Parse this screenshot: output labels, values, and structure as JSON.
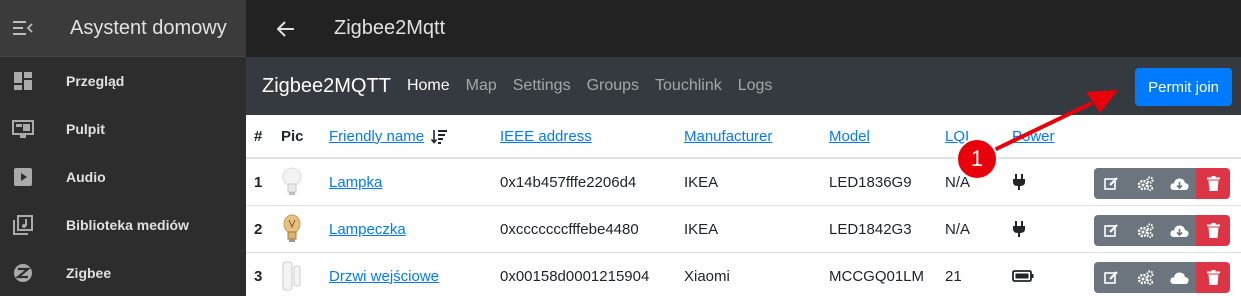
{
  "sidebar": {
    "title": "Asystent domowy",
    "items": [
      {
        "label": "Przegląd",
        "icon": "dashboard-icon"
      },
      {
        "label": "Pulpit",
        "icon": "monitor-icon"
      },
      {
        "label": "Audio",
        "icon": "play-icon"
      },
      {
        "label": "Biblioteka mediów",
        "icon": "media-library-icon"
      },
      {
        "label": "Zigbee",
        "icon": "zigbee-icon"
      }
    ]
  },
  "topbar": {
    "title": "Zigbee2Mqtt"
  },
  "znav": {
    "brand": "Zigbee2MQTT",
    "links": [
      "Home",
      "Map",
      "Settings",
      "Groups",
      "Touchlink",
      "Logs"
    ],
    "active": "Home",
    "permit_label": "Permit join"
  },
  "table": {
    "headers": {
      "num": "#",
      "pic": "Pic",
      "friendly": "Friendly name",
      "ieee": "IEEE address",
      "manufacturer": "Manufacturer",
      "model": "Model",
      "lqi": "LQI",
      "power": "Power"
    },
    "rows": [
      {
        "num": "1",
        "friendly": "Lampka",
        "ieee": "0x14b457fffe2206d4",
        "manufacturer": "IKEA",
        "model": "LED1836G9",
        "lqi": "N/A",
        "power": "plug-icon"
      },
      {
        "num": "2",
        "friendly": "Lampeczka",
        "ieee": "0xcccccccfffebe4480",
        "manufacturer": "IKEA",
        "model": "LED1842G3",
        "lqi": "N/A",
        "power": "plug-icon"
      },
      {
        "num": "3",
        "friendly": "Drzwi wejściowe",
        "ieee": "0x00158d0001215904",
        "manufacturer": "Xiaomi",
        "model": "MCCGQ01LM",
        "lqi": "21",
        "power": "battery-icon"
      }
    ]
  },
  "annotation": {
    "badge": "1"
  },
  "colors": {
    "primary": "#007bff",
    "danger": "#dc3545",
    "secondary": "#6c757d",
    "annotation": "#e8000b"
  }
}
